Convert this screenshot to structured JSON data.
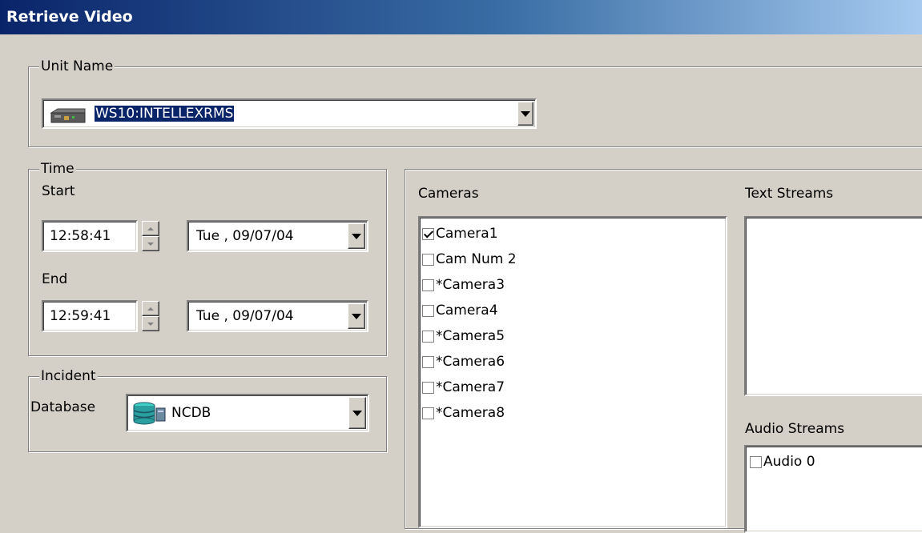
{
  "window": {
    "title": "Retrieve Video"
  },
  "unit_name": {
    "legend": "Unit Name",
    "selected": "WS10:INTELLEXRMS",
    "icon": "dvr-unit-icon"
  },
  "time": {
    "legend": "Time",
    "start_label": "Start",
    "end_label": "End",
    "start_time": "12:58:41",
    "start_date": "Tue , 09/07/04",
    "end_time": "12:59:41",
    "end_date": "Tue , 09/07/04"
  },
  "incident": {
    "legend": "Incident",
    "database_label": "Database",
    "database_value": "NCDB",
    "icon": "database-icon"
  },
  "cameras": {
    "label": "Cameras",
    "items": [
      {
        "label": "Camera1",
        "checked": true
      },
      {
        "label": "Cam Num 2",
        "checked": false
      },
      {
        "label": "*Camera3",
        "checked": false
      },
      {
        "label": "Camera4",
        "checked": false
      },
      {
        "label": "*Camera5",
        "checked": false
      },
      {
        "label": "*Camera6",
        "checked": false
      },
      {
        "label": "*Camera7",
        "checked": false
      },
      {
        "label": "*Camera8",
        "checked": false
      }
    ]
  },
  "text_streams": {
    "label": "Text Streams"
  },
  "audio_streams": {
    "label": "Audio Streams",
    "items": [
      {
        "label": "Audio 0",
        "checked": false
      }
    ]
  },
  "colors": {
    "dialog_bg": "#d4d0c8",
    "title_start": "#0a246a",
    "title_end": "#a6caf0",
    "selection": "#0a246a"
  }
}
